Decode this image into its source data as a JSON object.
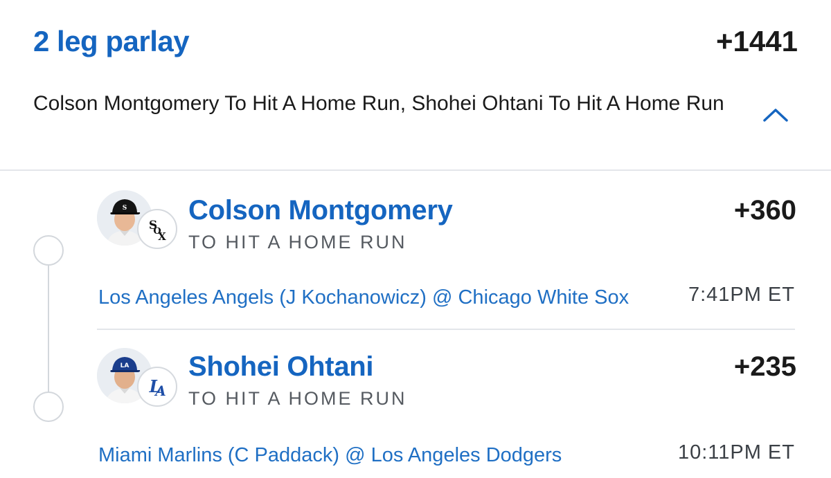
{
  "parlay": {
    "title": "2 leg parlay",
    "odds": "+1441",
    "description": "Colson Montgomery To Hit A Home Run, Shohei Ohtani To Hit A Home Run",
    "toggle_icon": "chevron-up-icon"
  },
  "legs": [
    {
      "player": "Colson Montgomery",
      "market": "TO HIT A HOME RUN",
      "odds": "+360",
      "game": "Los Angeles Angels (J Kochanowicz) @ Chicago White Sox",
      "time": "7:41PM ET",
      "team_icon": "white-sox-logo-icon"
    },
    {
      "player": "Shohei Ohtani",
      "market": "TO HIT A HOME RUN",
      "odds": "+235",
      "game": "Miami Marlins (C Paddack) @ Los Angeles Dodgers",
      "time": "10:11PM ET",
      "team_icon": "dodgers-logo-icon"
    }
  ],
  "colors": {
    "accent": "#1565c0",
    "link": "#1f6fc4",
    "text": "#1a1a1a",
    "muted": "#555a60",
    "divider": "#e3e6ea"
  }
}
